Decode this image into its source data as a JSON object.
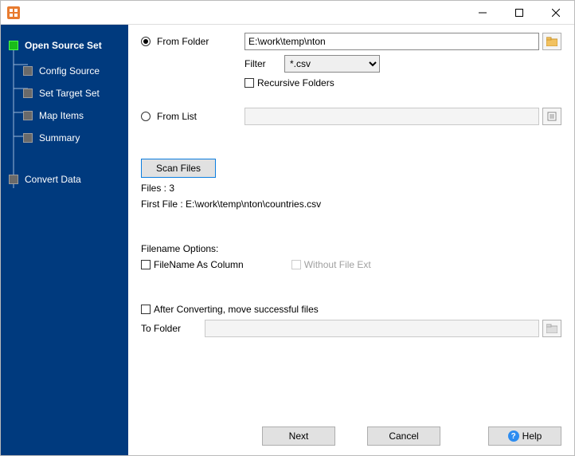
{
  "titlebar": {
    "title": ""
  },
  "sidebar": {
    "items": [
      {
        "label": "Open Source Set",
        "active": true,
        "level": 0
      },
      {
        "label": "Config Source",
        "active": false,
        "level": 1
      },
      {
        "label": "Set Target Set",
        "active": false,
        "level": 1
      },
      {
        "label": "Map Items",
        "active": false,
        "level": 1
      },
      {
        "label": "Summary",
        "active": false,
        "level": 1
      },
      {
        "label": "Convert Data",
        "active": false,
        "level": 0
      }
    ]
  },
  "form": {
    "from_folder_label": "From Folder",
    "from_folder_value": "E:\\work\\temp\\nton",
    "from_folder_selected": true,
    "filter_label": "Filter",
    "filter_value": "*.csv",
    "recursive_label": "Recursive Folders",
    "recursive_checked": false,
    "from_list_label": "From List",
    "from_list_value": "",
    "from_list_selected": false,
    "scan_button": "Scan Files",
    "files_count_label": "Files : 3",
    "first_file_label": "First File : E:\\work\\temp\\nton\\countries.csv",
    "filename_options_label": "Filename Options:",
    "filename_as_col_label": "FileName As Column",
    "filename_as_col_checked": false,
    "without_ext_label": "Without File Ext",
    "without_ext_checked": false,
    "after_convert_label": "After Converting, move successful files",
    "after_convert_checked": false,
    "to_folder_label": "To Folder",
    "to_folder_value": ""
  },
  "buttons": {
    "next": "Next",
    "cancel": "Cancel",
    "help": "Help"
  }
}
